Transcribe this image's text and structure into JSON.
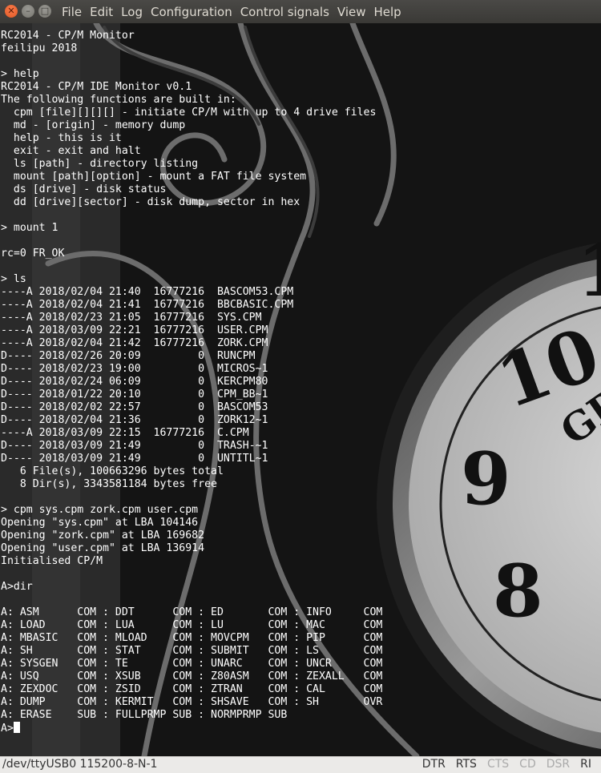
{
  "window": {
    "title": "",
    "menu": [
      "File",
      "Edit",
      "Log",
      "Configuration",
      "Control signals",
      "View",
      "Help"
    ]
  },
  "terminal": {
    "lines": [
      "RC2014 - CP/M Monitor",
      "feilipu 2018",
      "",
      "> help",
      "RC2014 - CP/M IDE Monitor v0.1",
      "The following functions are built in:",
      "  cpm [file][][][] - initiate CP/M with up to 4 drive files",
      "  md - [origin] - memory dump",
      "  help - this is it",
      "  exit - exit and halt",
      "  ls [path] - directory listing",
      "  mount [path][option] - mount a FAT file system",
      "  ds [drive] - disk status",
      "  dd [drive][sector] - disk dump, sector in hex",
      "",
      "> mount 1",
      "",
      "rc=0 FR_OK",
      "",
      "> ls",
      "----A 2018/02/04 21:40  16777216  BASCOM53.CPM",
      "----A 2018/02/04 21:41  16777216  BBCBASIC.CPM",
      "----A 2018/02/23 21:05  16777216  SYS.CPM",
      "----A 2018/03/09 22:21  16777216  USER.CPM",
      "----A 2018/02/04 21:42  16777216  ZORK.CPM",
      "D---- 2018/02/26 20:09         0  RUNCPM",
      "D---- 2018/02/23 19:00         0  MICROS~1",
      "D---- 2018/02/24 06:09         0  KERCPM80",
      "D---- 2018/01/22 20:10         0  CPM_BB~1",
      "D---- 2018/02/02 22:57         0  BASCOM53",
      "D---- 2018/02/04 21:36         0  ZORK12~1",
      "----A 2018/03/09 22:15  16777216  C.CPM",
      "D---- 2018/03/09 21:49         0  TRASH-~1",
      "D---- 2018/03/09 21:49         0  UNTITL~1",
      "   6 File(s), 100663296 bytes total",
      "   8 Dir(s), 3343581184 bytes free",
      "",
      "> cpm sys.cpm zork.cpm user.cpm",
      "Opening \"sys.cpm\" at LBA 104146",
      "Opening \"zork.cpm\" at LBA 169682",
      "Opening \"user.cpm\" at LBA 136914",
      "Initialised CP/M",
      "",
      "A>dir",
      "",
      "A: ASM      COM : DDT      COM : ED       COM : INFO     COM",
      "A: LOAD     COM : LUA      COM : LU       COM : MAC      COM",
      "A: MBASIC   COM : MLOAD    COM : MOVCPM   COM : PIP      COM",
      "A: SH       COM : STAT     COM : SUBMIT   COM : LS       COM",
      "A: SYSGEN   COM : TE       COM : UNARC    COM : UNCR     COM",
      "A: USQ      COM : XSUB     COM : Z80ASM   COM : ZEXALL   COM",
      "A: ZEXDOC   COM : ZSID     COM : ZTRAN    COM : CAL      COM",
      "A: DUMP     COM : KERMIT   COM : SHSAVE   COM : SH       OVR",
      "A: ERASE    SUB : FULLPRMP SUB : NORMPRMP SUB"
    ],
    "prompt": "A>"
  },
  "statusbar": {
    "port": "/dev/ttyUSB0  115200-8-N-1",
    "signals": [
      {
        "label": "DTR",
        "active": true
      },
      {
        "label": "RTS",
        "active": true
      },
      {
        "label": "CTS",
        "active": false
      },
      {
        "label": "CD",
        "active": false
      },
      {
        "label": "DSR",
        "active": false
      },
      {
        "label": "RI",
        "active": true
      }
    ]
  }
}
